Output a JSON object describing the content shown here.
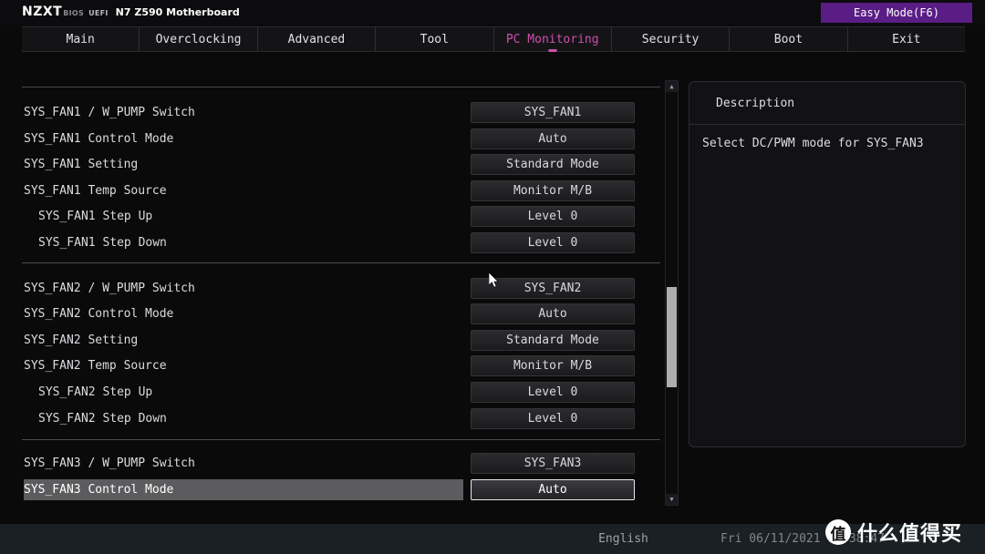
{
  "header": {
    "brand": "NZXT",
    "brand_bios": "BIOS",
    "brand_uefi": "UEFI",
    "board": "N7 Z590 Motherboard",
    "easy_mode_label": "Easy Mode(F6)",
    "accent_color": "#cf4fae",
    "easy_mode_color": "#5a1d85"
  },
  "tabs": [
    {
      "label": "Main",
      "active": false
    },
    {
      "label": "Overclocking",
      "active": false
    },
    {
      "label": "Advanced",
      "active": false
    },
    {
      "label": "Tool",
      "active": false
    },
    {
      "label": "PC Monitoring",
      "active": true
    },
    {
      "label": "Security",
      "active": false
    },
    {
      "label": "Boot",
      "active": false
    },
    {
      "label": "Exit",
      "active": false
    }
  ],
  "rows": [
    {
      "label": "SYS_FAN1 / W_PUMP Switch",
      "value": "SYS_FAN1",
      "indent": false,
      "selected": false
    },
    {
      "label": "SYS_FAN1 Control Mode",
      "value": "Auto",
      "indent": false,
      "selected": false
    },
    {
      "label": "SYS_FAN1 Setting",
      "value": "Standard Mode",
      "indent": false,
      "selected": false
    },
    {
      "label": "SYS_FAN1 Temp Source",
      "value": "Monitor M/B",
      "indent": false,
      "selected": false
    },
    {
      "label": "SYS_FAN1 Step Up",
      "value": "Level 0",
      "indent": true,
      "selected": false
    },
    {
      "label": "SYS_FAN1 Step Down",
      "value": "Level 0",
      "indent": true,
      "selected": false
    },
    {
      "label": "SYS_FAN2 / W_PUMP Switch",
      "value": "SYS_FAN2",
      "indent": false,
      "selected": false
    },
    {
      "label": "SYS_FAN2 Control Mode",
      "value": "Auto",
      "indent": false,
      "selected": false
    },
    {
      "label": "SYS_FAN2 Setting",
      "value": "Standard Mode",
      "indent": false,
      "selected": false
    },
    {
      "label": "SYS_FAN2 Temp Source",
      "value": "Monitor M/B",
      "indent": false,
      "selected": false
    },
    {
      "label": "SYS_FAN2 Step Up",
      "value": "Level 0",
      "indent": true,
      "selected": false
    },
    {
      "label": "SYS_FAN2 Step Down",
      "value": "Level 0",
      "indent": true,
      "selected": false
    },
    {
      "label": "SYS_FAN3 / W_PUMP Switch",
      "value": "SYS_FAN3",
      "indent": false,
      "selected": false
    },
    {
      "label": "SYS_FAN3 Control Mode",
      "value": "Auto",
      "indent": false,
      "selected": true
    }
  ],
  "description": {
    "title": "Description",
    "text": "Select DC/PWM mode for SYS_FAN3"
  },
  "scrollbar": {
    "up_icon": "triangle-up-icon",
    "down_icon": "triangle-down-icon"
  },
  "statusbar": {
    "language": "English",
    "datetime": "Fri 06/11/2021 13:38:47"
  },
  "watermark": {
    "badge": "值",
    "text": "什么值得买"
  }
}
